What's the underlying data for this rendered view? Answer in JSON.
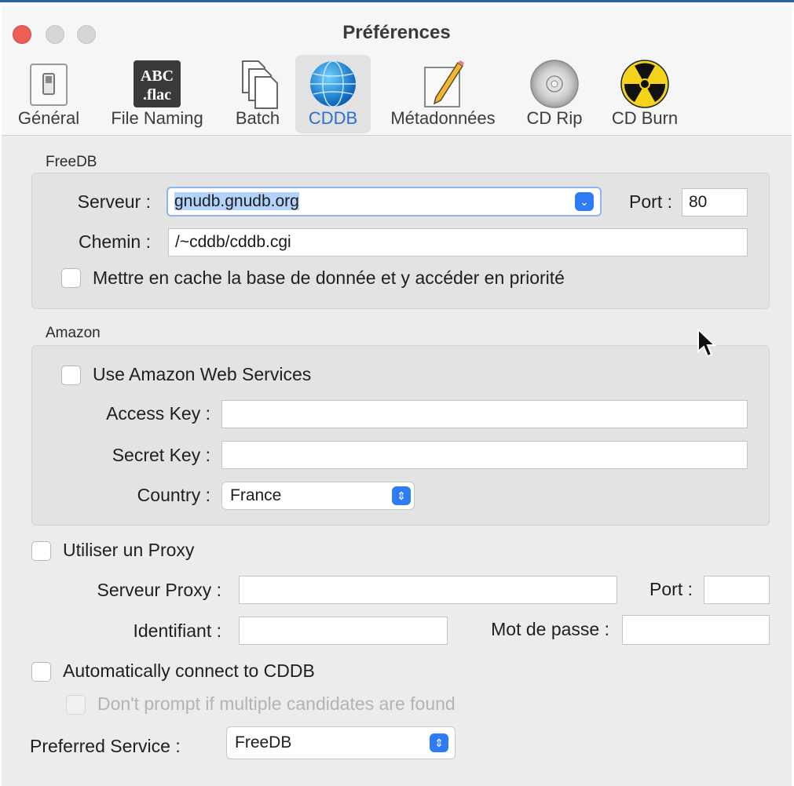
{
  "window": {
    "title": "Préférences"
  },
  "toolbar": {
    "items": [
      {
        "label": "Général",
        "icon": "general-switch-icon"
      },
      {
        "label": "File Naming",
        "icon": "abc-flac-icon",
        "icon_text_1": "ABC",
        "icon_text_2": ".flac"
      },
      {
        "label": "Batch",
        "icon": "batch-documents-icon"
      },
      {
        "label": "CDDB",
        "icon": "globe-icon",
        "selected": true
      },
      {
        "label": "Métadonnées",
        "icon": "pencil-note-icon"
      },
      {
        "label": "CD Rip",
        "icon": "cd-disc-icon"
      },
      {
        "label": "CD Burn",
        "icon": "radiation-icon"
      }
    ]
  },
  "freedb": {
    "section_label": "FreeDB",
    "server_label": "Serveur :",
    "server_value": "gnudb.gnudb.org",
    "port_label": "Port :",
    "port_value": "80",
    "path_label": "Chemin :",
    "path_value": "/~cddb/cddb.cgi",
    "cache_label": "Mettre en cache la base de donnée et y accéder en priorité"
  },
  "amazon": {
    "section_label": "Amazon",
    "use_label": "Use Amazon Web Services",
    "access_key_label": "Access Key :",
    "access_key_value": "",
    "secret_key_label": "Secret Key :",
    "secret_key_value": "",
    "country_label": "Country :",
    "country_value": "France"
  },
  "proxy": {
    "use_label": "Utiliser un Proxy",
    "server_label": "Serveur Proxy :",
    "port_label": "Port :",
    "id_label": "Identifiant :",
    "password_label": "Mot de passe :"
  },
  "cddb": {
    "auto_connect_label": "Automatically connect to CDDB",
    "no_prompt_label": "Don't prompt if multiple candidates are found",
    "preferred_label": "Preferred Service :",
    "preferred_value": "FreeDB"
  },
  "colors": {
    "accent": "#2d7cf6",
    "close": "#ec5f57",
    "selection": "#b4d3fb"
  }
}
